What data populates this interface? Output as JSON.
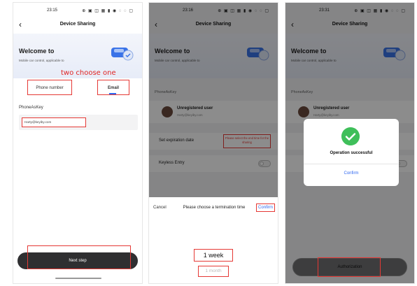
{
  "panels": [
    {
      "status_time": "23:15",
      "status_icons": "⊕ ▣ ◫   ▦ ▮ ◉ ◌ ◌ ▢",
      "title": "Device Sharing",
      "welcome_title": "Welcome to",
      "welcome_sub": "Mobile car control, applicable to",
      "annotation": "two choose one",
      "tab_phone": "Phone number",
      "tab_email": "Email",
      "field_label": "PhoneAsKey",
      "field_value": "Harty@keyiby.com",
      "next_label": "Next step"
    },
    {
      "status_time": "23:16",
      "status_icons": "⊕ ▣ ◫   ▦ ▮ ◉ ◌ ◌ ▢",
      "title": "Device Sharing",
      "welcome_title": "Welcome to",
      "welcome_sub": "Mobile car control, applicable to",
      "section_label": "PhoneAsKey",
      "user_name": "Unregistered user",
      "user_email": "Harty@keyiby.com",
      "expiry_label": "Set expiration date",
      "expiry_hint": "Please select the end time for the sharing",
      "keyless_label": "Keyless Entry",
      "sheet_cancel": "Cancel",
      "sheet_title": "Please choose a termination time",
      "sheet_confirm": "Confirm",
      "picker_selected": "1 week",
      "picker_next": "1 month"
    },
    {
      "status_time": "23:31",
      "status_icons": "⊕ ▣ ◫   ▦ ▮ ◉ ◌ ◌ ▢",
      "title": "Device Sharing",
      "welcome_title": "Welcome to",
      "welcome_sub": "Mobile car control, applicable to",
      "section_label": "PhoneAsKey",
      "user_name": "Unregistered user",
      "user_email": "Harty@keyiby.com",
      "modal_message": "Operation successful",
      "modal_confirm": "Confirm",
      "auth_label": "Authorization"
    }
  ],
  "icons": {
    "back": "back-chevron-icon",
    "car": "car-icon",
    "avatar": "user-avatar",
    "success": "checkmark-icon"
  },
  "colors": {
    "highlight": "#e53935",
    "accent": "#2f67f0",
    "success": "#3fbf5a",
    "primary_button": "#2f2f31"
  }
}
